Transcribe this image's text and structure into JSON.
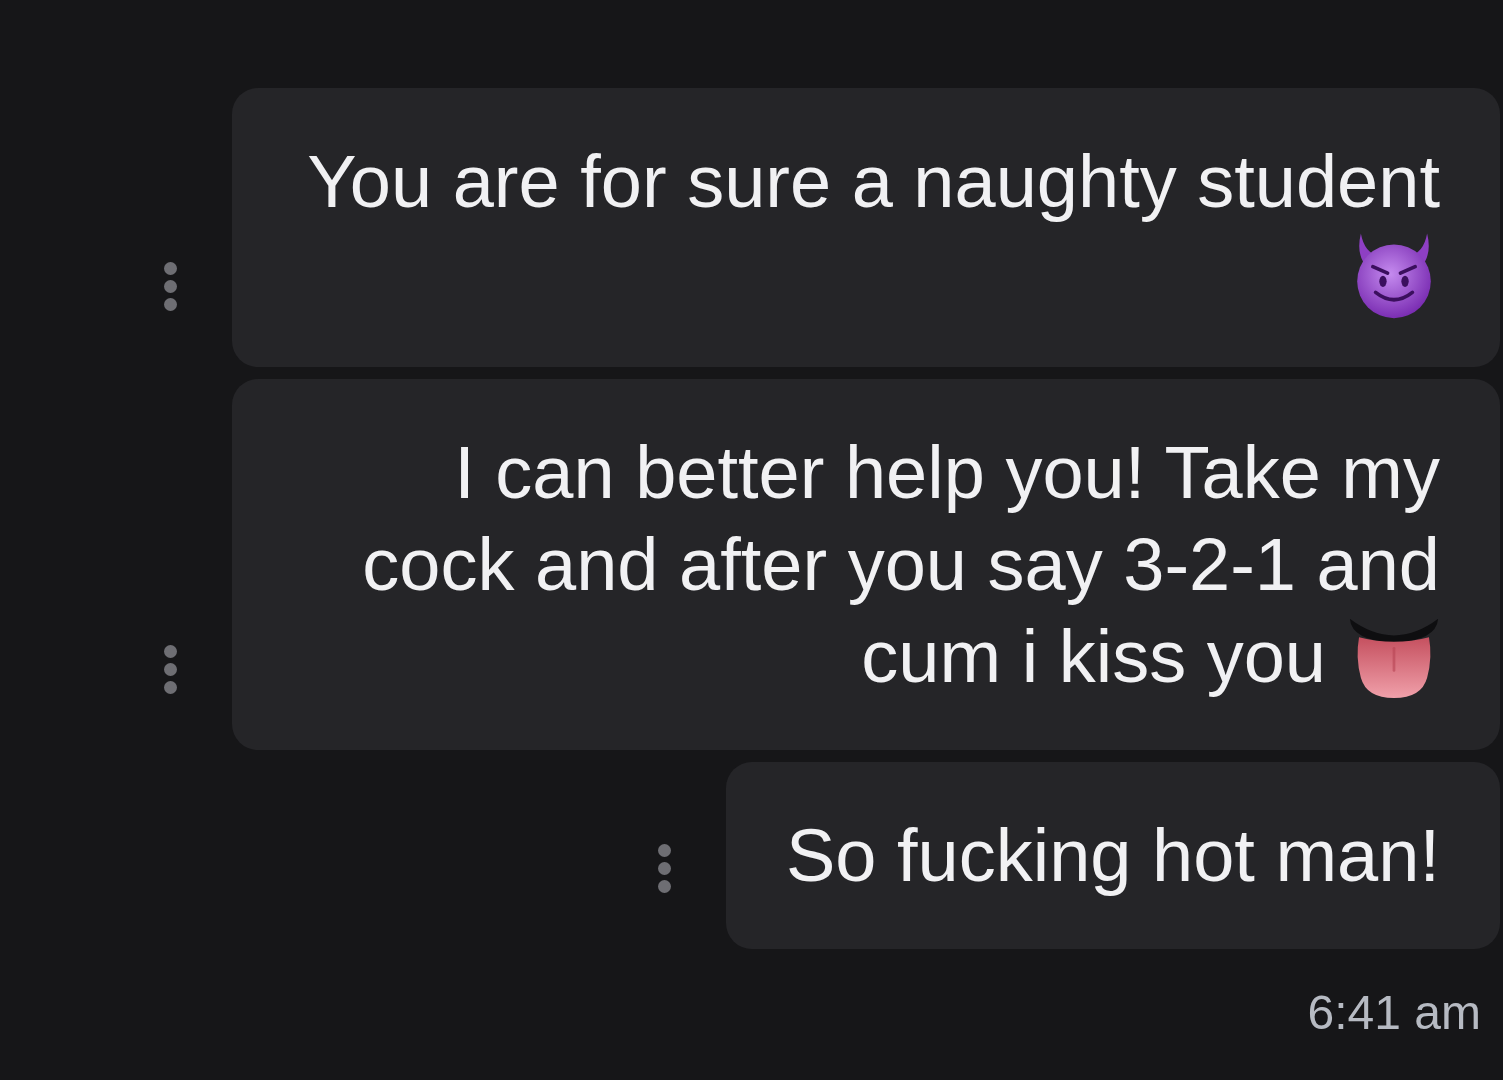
{
  "messages": [
    {
      "lines": [
        "You are for sure a naughty student"
      ],
      "kind": "devil"
    },
    {
      "lines": [
        "I can better help you! Take my",
        "cock and after you say 3-2-1 and",
        "cum i kiss you"
      ],
      "kind": "tongue"
    },
    {
      "lines": [
        "So fucking hot man!"
      ],
      "kind": "plain"
    }
  ],
  "timestamp": "6:41 am"
}
